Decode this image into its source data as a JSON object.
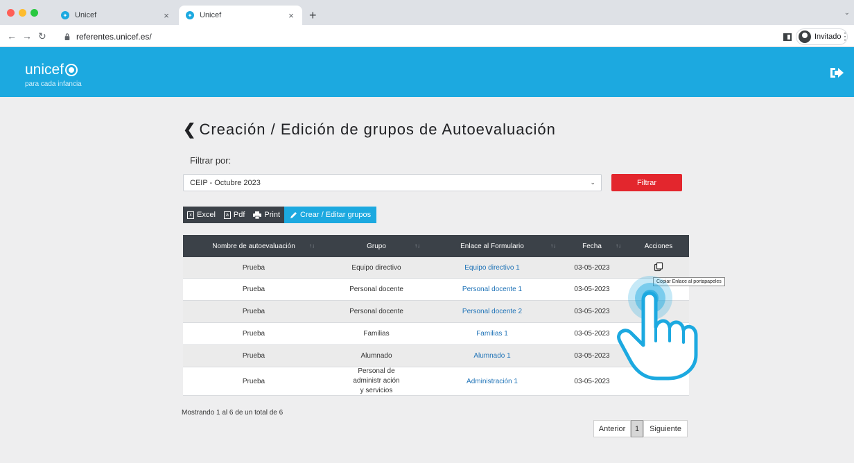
{
  "browser": {
    "tabs": [
      {
        "title": "Unicef",
        "active": false
      },
      {
        "title": "Unicef",
        "active": true
      }
    ],
    "url": "referentes.unicef.es/",
    "profile_label": "Invitado"
  },
  "header": {
    "brand": "unicef",
    "tagline": "para cada infancia"
  },
  "page": {
    "title": "Creación / Edición de grupos de Autoevaluación",
    "filter_label": "Filtrar por:",
    "filter_value": "CEIP - Octubre 2023",
    "filter_button": "Filtrar",
    "export_buttons": [
      "Excel",
      "Pdf",
      "Print"
    ],
    "create_button": "Crear / Editar grupos"
  },
  "table": {
    "columns": [
      "Nombre de autoevaluación",
      "Grupo",
      "Enlace al Formulario",
      "Fecha",
      "Acciones"
    ],
    "rows": [
      {
        "nombre": "Prueba",
        "grupo": "Equipo directivo",
        "enlace": "Equipo directivo 1",
        "fecha": "03-05-2023"
      },
      {
        "nombre": "Prueba",
        "grupo": "Personal docente",
        "enlace": "Personal docente 1",
        "fecha": "03-05-2023"
      },
      {
        "nombre": "Prueba",
        "grupo": "Personal docente",
        "enlace": "Personal docente 2",
        "fecha": "03-05-2023"
      },
      {
        "nombre": "Prueba",
        "grupo": "Familias",
        "enlace": "Familias 1",
        "fecha": "03-05-2023"
      },
      {
        "nombre": "Prueba",
        "grupo": "Alumnado",
        "enlace": "Alumnado 1",
        "fecha": "03-05-2023"
      },
      {
        "nombre": "Prueba",
        "grupo": "Personal de administr ación y servicios",
        "enlace": "Administración 1",
        "fecha": "03-05-2023"
      }
    ],
    "tooltip": "Copiar Enlace al portapapeles",
    "info": "Mostrando 1 al 6 de un total de 6"
  },
  "pagination": {
    "prev": "Anterior",
    "current": "1",
    "next": "Siguiente"
  },
  "colors": {
    "brand_blue": "#1ca9e0",
    "filter_red": "#e3262d",
    "table_header": "#3b4148",
    "link_blue": "#1f73b7"
  },
  "icons": [
    "back-chevron-icon",
    "logout-icon",
    "copy-link-icon",
    "excel-icon",
    "pdf-icon",
    "print-icon",
    "pencil-icon",
    "pointer-hand-icon"
  ]
}
